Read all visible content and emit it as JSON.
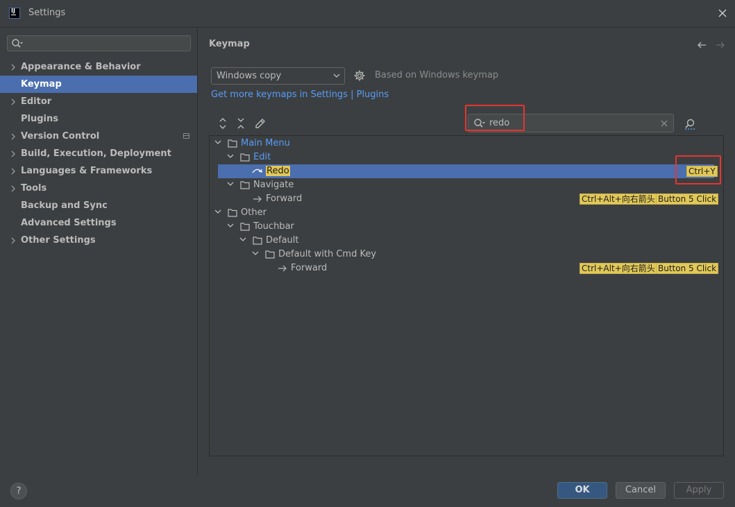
{
  "window": {
    "title": "Settings",
    "app_icon_text": "IJ"
  },
  "sidebar": {
    "search_placeholder": "",
    "items": [
      {
        "label": "Appearance & Behavior",
        "expandable": true
      },
      {
        "label": "Keymap",
        "selected": true
      },
      {
        "label": "Editor",
        "expandable": true
      },
      {
        "label": "Plugins"
      },
      {
        "label": "Version Control",
        "expandable": true
      },
      {
        "label": "Build, Execution, Deployment",
        "expandable": true
      },
      {
        "label": "Languages & Frameworks",
        "expandable": true
      },
      {
        "label": "Tools",
        "expandable": true
      },
      {
        "label": "Backup and Sync"
      },
      {
        "label": "Advanced Settings"
      },
      {
        "label": "Other Settings",
        "expandable": true
      }
    ]
  },
  "main": {
    "title": "Keymap",
    "keymap_select": {
      "value": "Windows copy"
    },
    "based_on": "Based on Windows keymap",
    "more_keymaps_link": "Get more keymaps in Settings | Plugins",
    "filter": {
      "value": "redo"
    }
  },
  "tree": [
    {
      "label": "Main Menu",
      "shortcuts": []
    },
    {
      "label": "Edit",
      "shortcuts": []
    },
    {
      "label": "Redo",
      "shortcuts": [
        "Ctrl+Y"
      ]
    },
    {
      "label": "Navigate",
      "shortcuts": []
    },
    {
      "label": "Forward",
      "shortcuts": [
        "Ctrl+Alt+向右箭头",
        "Button 5 Click"
      ]
    },
    {
      "label": "Other",
      "shortcuts": []
    },
    {
      "label": "Touchbar",
      "shortcuts": []
    },
    {
      "label": "Default",
      "shortcuts": []
    },
    {
      "label": "Default with Cmd Key",
      "shortcuts": []
    },
    {
      "label": "Forward",
      "shortcuts": [
        "Ctrl+Alt+向右箭头",
        "Button 5 Click"
      ]
    }
  ],
  "buttons": {
    "help": "?",
    "ok": "OK",
    "cancel": "Cancel",
    "apply": "Apply"
  },
  "colors": {
    "accent": "#4b6eaf",
    "link": "#589df6",
    "highlight": "#e1c858",
    "annotation": "#e8342f"
  },
  "icons": [
    "search-icon",
    "close-icon",
    "chevron-right-icon",
    "chevron-down-icon",
    "gear-icon",
    "back-arrow-icon",
    "forward-arrow-icon",
    "expand-all-icon",
    "collapse-all-icon",
    "edit-icon",
    "find-shortcut-icon",
    "folder-icon",
    "redo-icon",
    "arrow-right-icon"
  ]
}
